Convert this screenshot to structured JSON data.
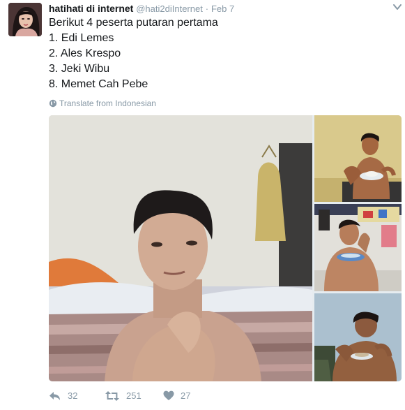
{
  "tweet": {
    "display_name": "hatihati di internet",
    "handle": "@hati2diInternet",
    "separator": "·",
    "time": "Feb 7",
    "lines": [
      "Berikut 4 peserta putaran pertama",
      "1. Edi Lemes",
      "2. Ales Krespo",
      "3. Jeki Wibu",
      "8. Memet Cah Pebe"
    ],
    "translate_label": "Translate from Indonesian",
    "icons": {
      "menu": "chevron-down-icon",
      "translate": "globe-icon",
      "reply": "reply-icon",
      "retweet": "retweet-icon",
      "like": "heart-icon"
    }
  },
  "actions": {
    "reply_count": "32",
    "retweet_count": "251",
    "like_count": "27"
  },
  "colors": {
    "text": "#14171a",
    "muted": "#8899a6"
  }
}
